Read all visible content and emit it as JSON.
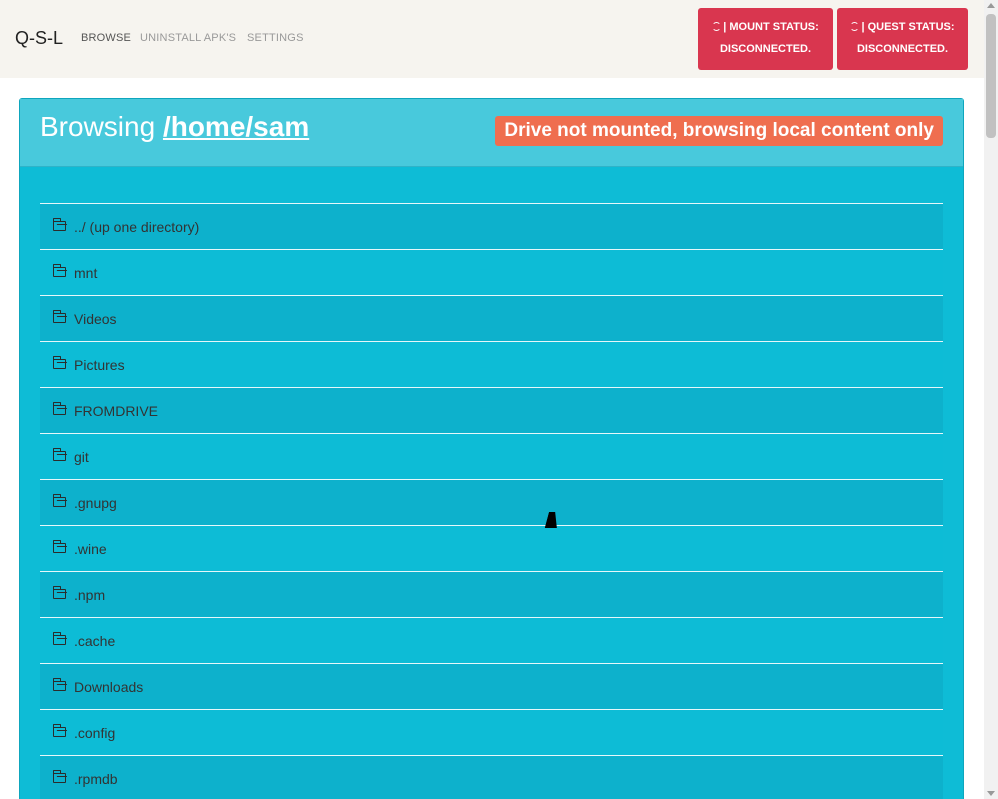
{
  "navbar": {
    "brand": "Q-S-L",
    "links": [
      {
        "label": "BROWSE",
        "active": true
      },
      {
        "label": "UNINSTALL APK'S",
        "active": false
      },
      {
        "label": "SETTINGS",
        "active": false
      }
    ],
    "mount_status": {
      "line1": "| MOUNT STATUS:",
      "line2": "DISCONNECTED."
    },
    "quest_status": {
      "line1": "| QUEST STATUS:",
      "line2": "DISCONNECTED."
    },
    "status_color": "#d9364f",
    "refresh_icon": "refresh-icon"
  },
  "browser": {
    "prefix": "Browsing ",
    "path": "/home/sam",
    "warning": "Drive not mounted, browsing local content only",
    "warning_color": "#ef6e4f",
    "folder_icon": "folder-open-icon",
    "items": [
      "../ (up one directory)",
      "mnt",
      "Videos",
      "Pictures",
      "FROMDRIVE",
      "git",
      ".gnupg",
      ".wine",
      ".npm",
      ".cache",
      "Downloads",
      ".config",
      ".rpmdb"
    ]
  }
}
